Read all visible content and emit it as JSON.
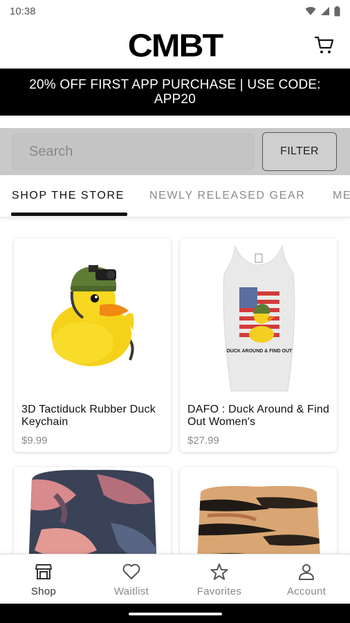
{
  "status_bar": {
    "time": "10:38"
  },
  "header": {
    "brand": "CMBT"
  },
  "promo": {
    "line1": "20% OFF FIRST APP PURCHASE | USE CODE:",
    "line2": "APP20"
  },
  "search": {
    "placeholder": "Search",
    "filter_label": "FILTER"
  },
  "tabs": [
    {
      "label": "SHOP THE STORE",
      "active": true
    },
    {
      "label": "NEWLY RELEASED GEAR",
      "active": false
    },
    {
      "label": "ME",
      "active": false
    }
  ],
  "products": [
    {
      "title": "3D Tactiduck Rubber Duck Keychain",
      "price": "$9.99"
    },
    {
      "title": "DAFO : Duck Around & Find Out Women's",
      "price": "$27.99",
      "tank_print": "DUCK AROUND & FIND OUT"
    },
    {
      "title": "",
      "price": ""
    },
    {
      "title": "",
      "price": ""
    }
  ],
  "bottom_nav": [
    {
      "label": "Shop",
      "icon": "shop-icon",
      "active": true
    },
    {
      "label": "Waitlist",
      "icon": "heart-icon",
      "active": false
    },
    {
      "label": "Favorites",
      "icon": "star-icon",
      "active": false
    },
    {
      "label": "Account",
      "icon": "person-icon",
      "active": false
    }
  ],
  "colors": {
    "banner_bg": "#000000",
    "search_band": "#c9c9c9",
    "accent": "#111111"
  }
}
